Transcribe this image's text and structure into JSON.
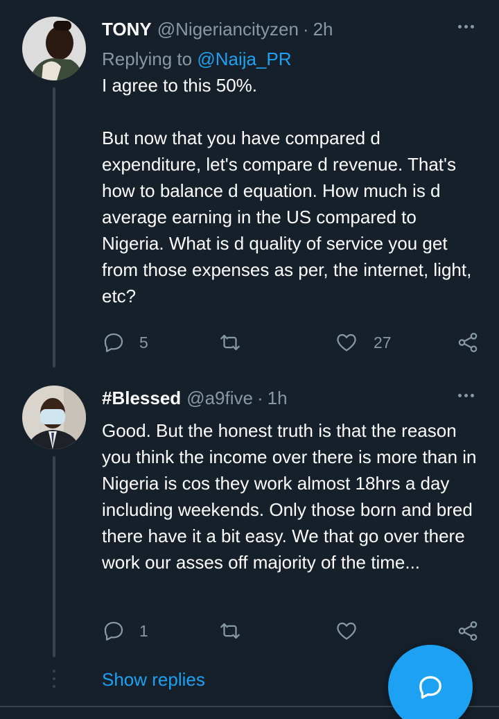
{
  "tweets": [
    {
      "name": "TONY",
      "handle": "@Nigeriancityzen",
      "separator": "·",
      "time": "2h",
      "replying_prefix": "Replying to",
      "replying_to": "@Naija_PR",
      "text": "I agree to this 50%.\n\nBut now that you have compared d expenditure, let's compare d revenue. That's how to balance d equation. How much is d average earning in the US compared to Nigeria. What is d quality of service you get from those expenses as per, the internet, light, etc?",
      "replies": "5",
      "retweets": "",
      "likes": "27"
    },
    {
      "name": "#Blessed",
      "handle": "@a9five",
      "separator": "·",
      "time": "1h",
      "text": "Good. But the honest truth is that the reason you think the income over there is more than in Nigeria is cos they work almost 18hrs a day including weekends. Only those born and bred there have it a bit easy. We that go over there work our asses off majority of the time...",
      "replies": "1",
      "retweets": "",
      "likes": ""
    }
  ],
  "show_replies_label": "Show replies",
  "icons": {
    "reply": "reply-icon",
    "retweet": "retweet-icon",
    "like": "heart-icon",
    "share": "share-icon",
    "more": "more-icon",
    "compose": "compose-reply-icon"
  },
  "colors": {
    "background": "#15202b",
    "accent": "#1da1f2",
    "muted": "#8899a6"
  }
}
